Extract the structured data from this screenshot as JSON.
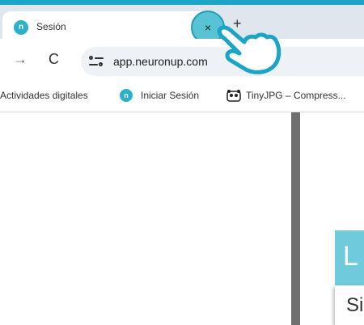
{
  "tab": {
    "title": "Sesión",
    "favicon_text": "n",
    "close_glyph": "×"
  },
  "new_tab_glyph": "+",
  "nav": {
    "forward_glyph": "→",
    "reload_glyph": "C"
  },
  "address": {
    "url": "app.neuronup.com"
  },
  "bookmarks": [
    {
      "label": "Actividades digitales"
    },
    {
      "label": "Iniciar Sesión",
      "icon": "neuronup-favicon-icon"
    },
    {
      "label": "TinyJPG – Compress...",
      "icon": "panda-icon"
    }
  ],
  "card": {
    "title_fragment": "L",
    "body_fragment": "Si"
  },
  "colors": {
    "accent": "#1aa5c7",
    "card_header": "#6fcadb",
    "divider": "#707070"
  }
}
